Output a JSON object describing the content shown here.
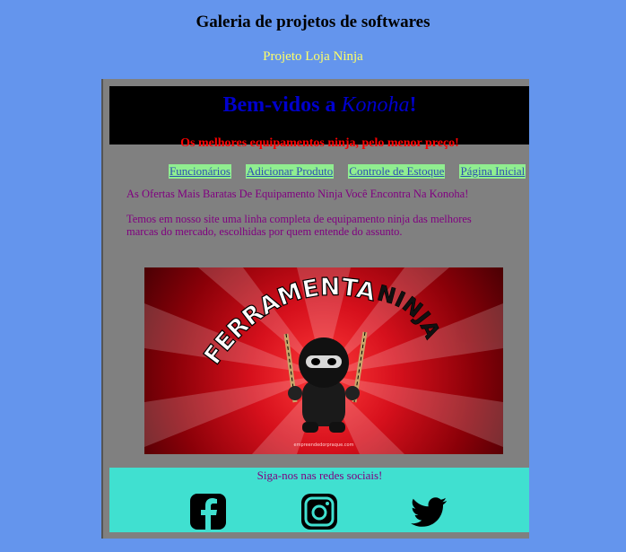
{
  "page": {
    "title": "Galeria de projetos de softwares",
    "project_link": "Projeto Loja Ninja"
  },
  "site": {
    "welcome_prefix": "Bem-vidos a ",
    "welcome_village": "Konoha",
    "welcome_suffix": "!",
    "tagline": "Os melhores equipamentos ninja, pelo menor preço!",
    "nav": [
      "Funcionários",
      "Adicionar Produto",
      "Controle de Estoque",
      "Página Inicial"
    ],
    "offer_text": "As Ofertas Mais Baratas De Equipamento Ninja Você Encontra Na Konoha!",
    "intro_text": "Temos em nosso site uma linha completa de equipamento ninja das melhores marcas do mercado, escolhidas por quem entende do assunto.",
    "banner": {
      "word_1": "FERRAMENTAS",
      "word_2": "NINJA",
      "credit": "empreendedorpraque.com"
    },
    "footer": {
      "follow_text": "Siga-nos nas redes sociais!",
      "icons": [
        "facebook-icon",
        "instagram-icon",
        "twitter-icon"
      ]
    }
  },
  "colors": {
    "page_background": "#6495ED",
    "content_background": "#808080",
    "header_background": "#000000",
    "welcome": "#0000CD",
    "tagline": "#FF0000",
    "nav_background": "#90EE90",
    "body_text": "#800080",
    "footer_background": "#40E0D0",
    "project_link": "#FFFF66"
  }
}
